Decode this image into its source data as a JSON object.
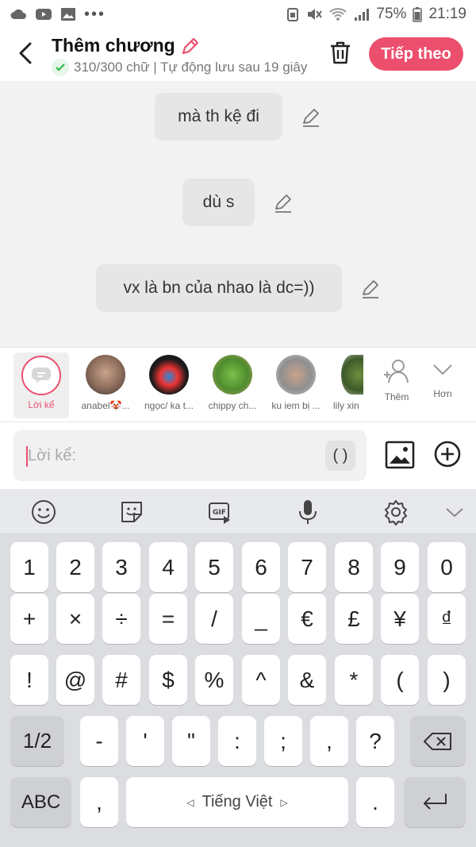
{
  "status_bar": {
    "battery": "75%",
    "time": "21:19"
  },
  "header": {
    "title": "Thêm chương",
    "subtitle": "310/300 chữ | Tự động lưu sau 19 giây",
    "next_label": "Tiếp theo"
  },
  "messages": [
    {
      "text": "mà th kệ đi"
    },
    {
      "text": "dù s"
    },
    {
      "text": "vx là bn của nhao là dc=))"
    }
  ],
  "characters": [
    {
      "name": "Lời kể",
      "selected": true
    },
    {
      "name": "anabel🤡..."
    },
    {
      "name": "ngọc/ ka t..."
    },
    {
      "name": "chippy ch..."
    },
    {
      "name": "ku iem bị ..."
    },
    {
      "name": "lily xin"
    }
  ],
  "strip_actions": {
    "add_label": "Thêm",
    "more_label": "Hơn"
  },
  "composer": {
    "placeholder": "Lời kể:",
    "paren_label": "( )"
  },
  "keyboard": {
    "row1": [
      "1",
      "2",
      "3",
      "4",
      "5",
      "6",
      "7",
      "8",
      "9",
      "0"
    ],
    "row2": [
      "+",
      "×",
      "÷",
      "=",
      "/",
      "_",
      "€",
      "£",
      "¥",
      "₫"
    ],
    "row3": [
      "!",
      "@",
      "#",
      "$",
      "%",
      "^",
      "&",
      "*",
      "(",
      ")"
    ],
    "row4": [
      "1/2",
      "-",
      "'",
      "\"",
      ":",
      ";",
      ",",
      "?"
    ],
    "abc_label": "ABC",
    "comma_label": ",",
    "space_label": "Tiếng Việt",
    "period_label": "."
  },
  "colors": {
    "accent": "#ec4f6e",
    "check": "#2eb84b"
  }
}
